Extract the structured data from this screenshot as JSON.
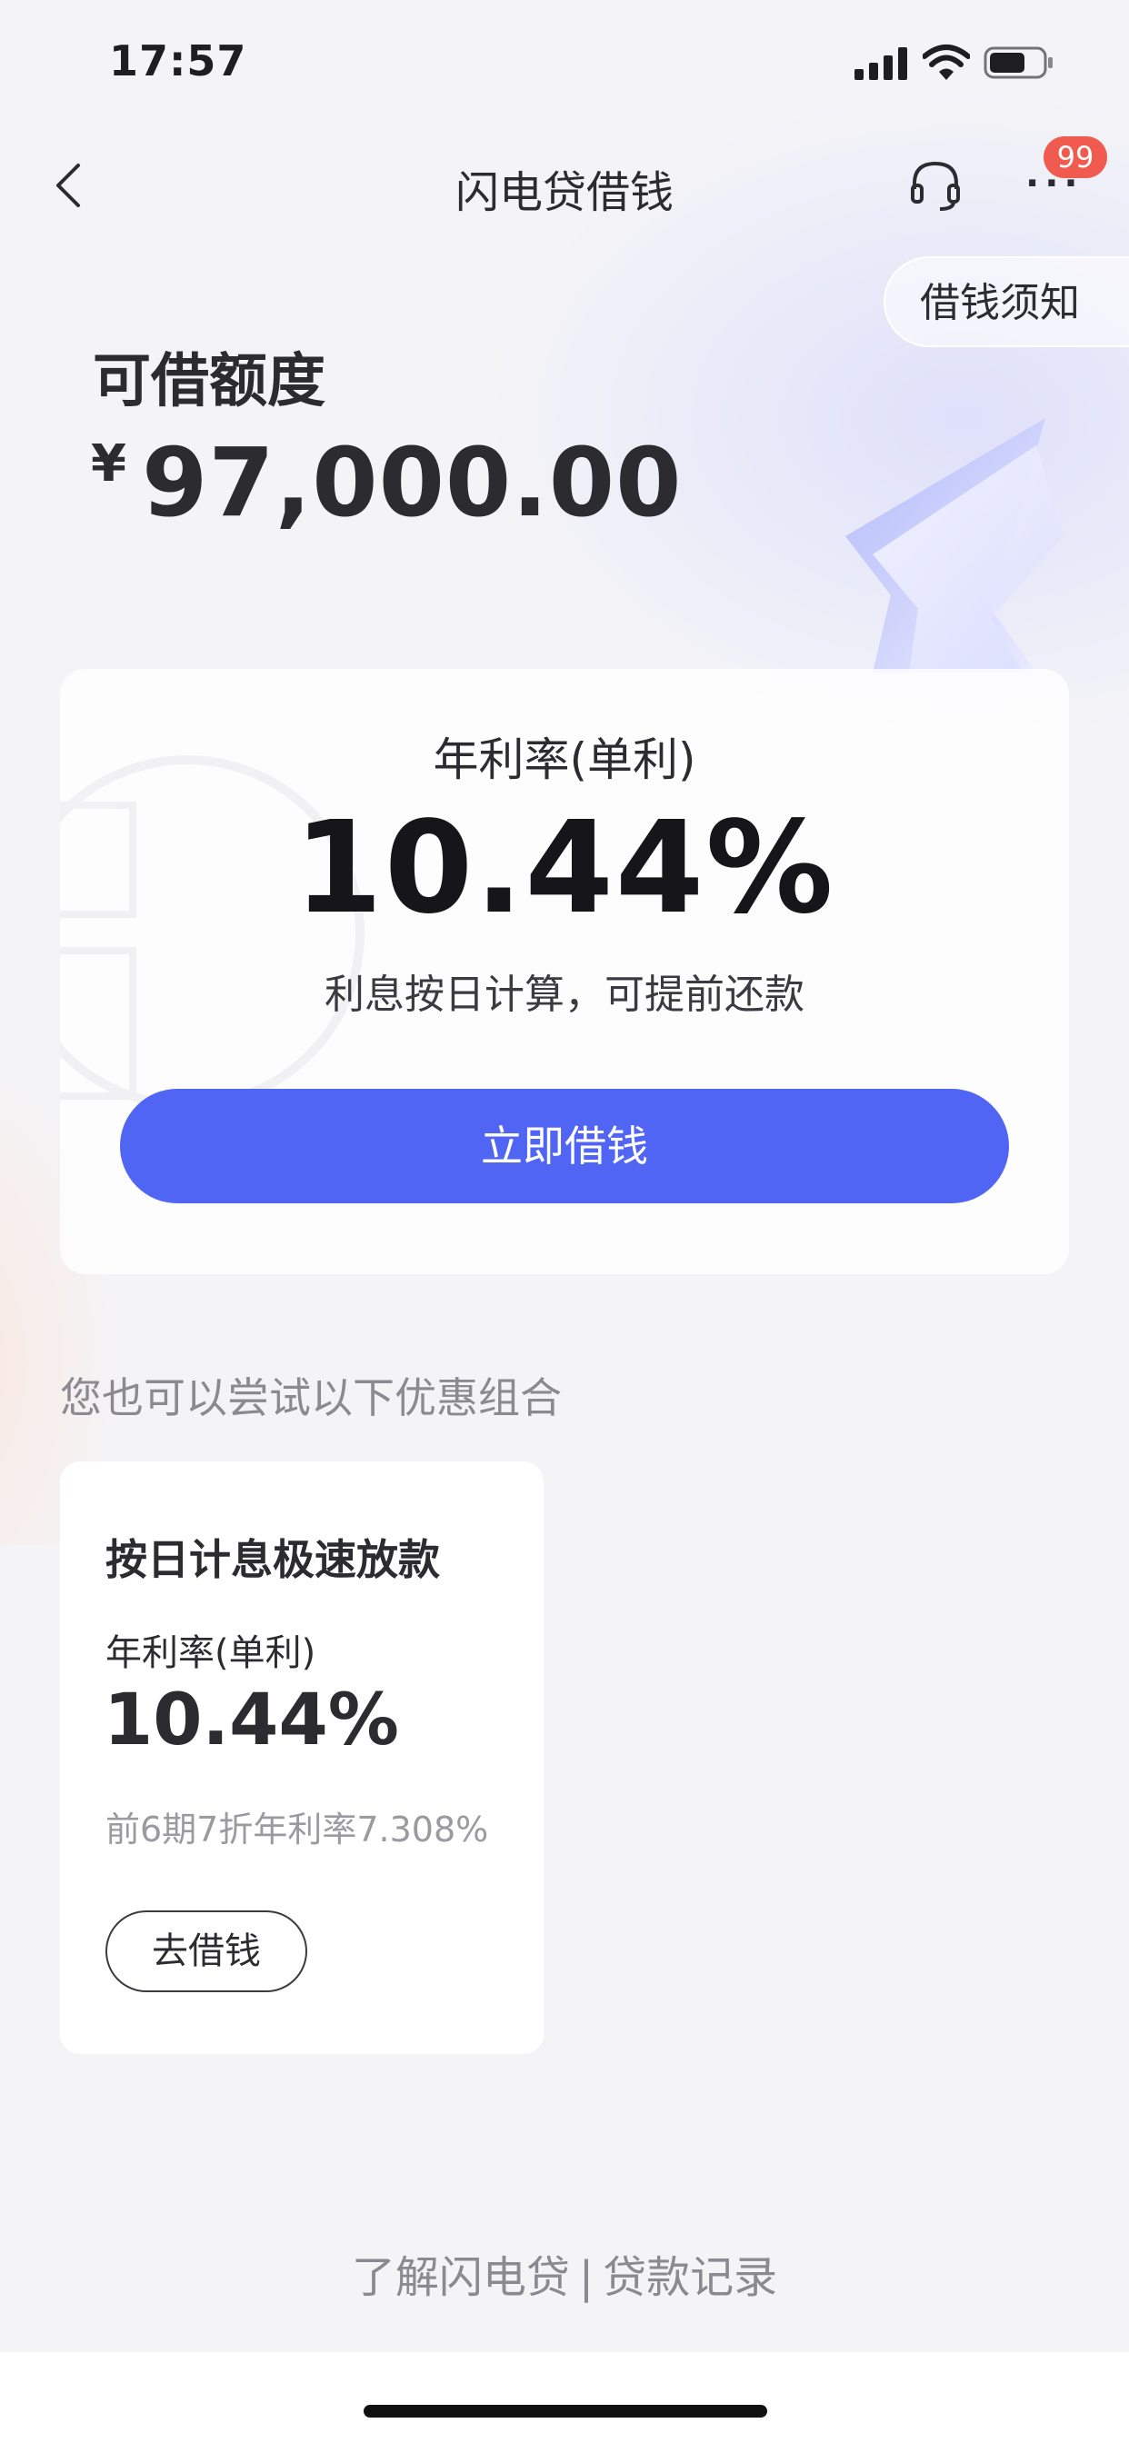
{
  "status_bar": {
    "time": "17:57"
  },
  "nav": {
    "title": "闪电贷借钱",
    "badge_count": "99",
    "icons": [
      "back-icon",
      "headset-icon",
      "more-icon"
    ]
  },
  "notice_button": "借钱须知",
  "limit": {
    "label": "可借额度",
    "currency": "¥",
    "amount": "97,000.00"
  },
  "main_card": {
    "rate_label": "年利率(单利)",
    "rate_value": "10.44%",
    "description": "利息按日计算，可提前还款",
    "borrow_button": "立即借钱"
  },
  "suggestion_label": "您也可以尝试以下优惠组合",
  "offer": {
    "title": "按日计息极速放款",
    "rate_label": "年利率(单利)",
    "rate_value": "10.44%",
    "discount_note": "前6期7折年利率7.308%",
    "button": "去借钱"
  },
  "footer": {
    "learn_more": "了解闪电贷",
    "separator": "|",
    "loan_records": "贷款记录"
  },
  "colors": {
    "accent": "#5165f4",
    "badge": "#f05a4f",
    "background": "#f4f4f7"
  }
}
